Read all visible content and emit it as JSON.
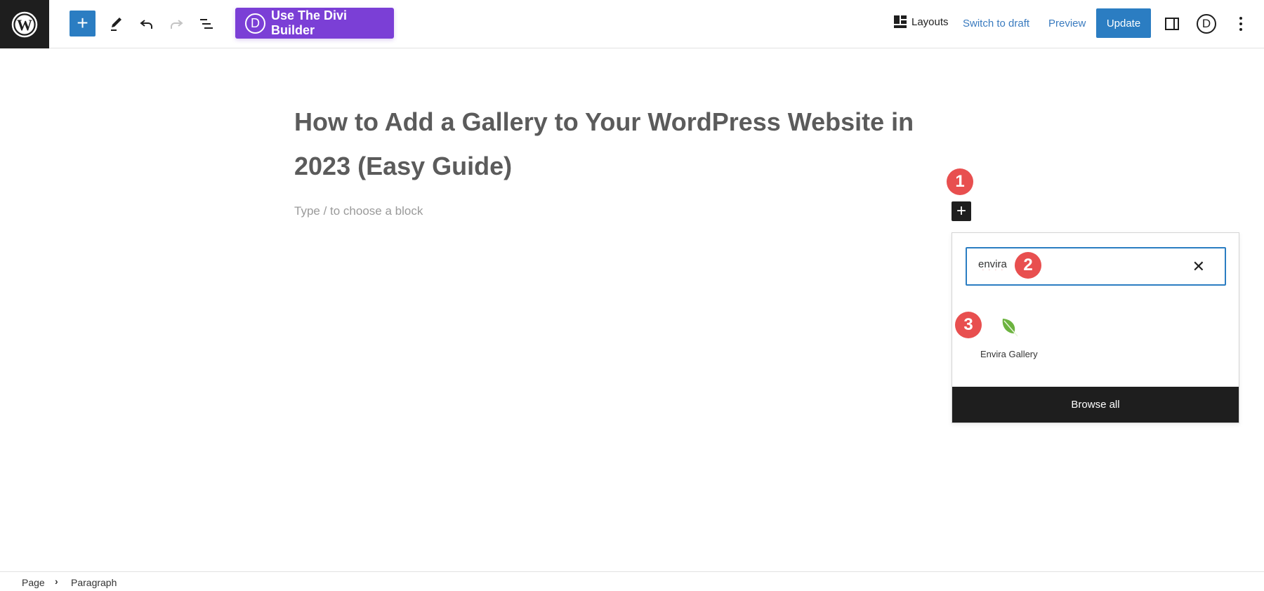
{
  "toolbar": {
    "add_block_icon": "plus-icon",
    "divi_button": "Use The Divi Builder",
    "divi_icon_letter": "D",
    "layouts": "Layouts",
    "switch_to_draft": "Switch to draft",
    "preview": "Preview",
    "update": "Update",
    "divi_circle_letter": "D",
    "accent_color": "#2b7dc2",
    "divi_color": "#7b3fd6"
  },
  "editor": {
    "title": "How to Add a Gallery to Your WordPress Website in 2023 (Easy Guide)",
    "placeholder": "Type / to choose a block"
  },
  "annotations": [
    "1",
    "2",
    "3"
  ],
  "inserter": {
    "search_value": "envira",
    "results": [
      {
        "label": "Envira Gallery",
        "icon": "leaf-icon"
      }
    ],
    "browse_all": "Browse all"
  },
  "footer": {
    "breadcrumb": [
      "Page",
      "Paragraph"
    ]
  }
}
